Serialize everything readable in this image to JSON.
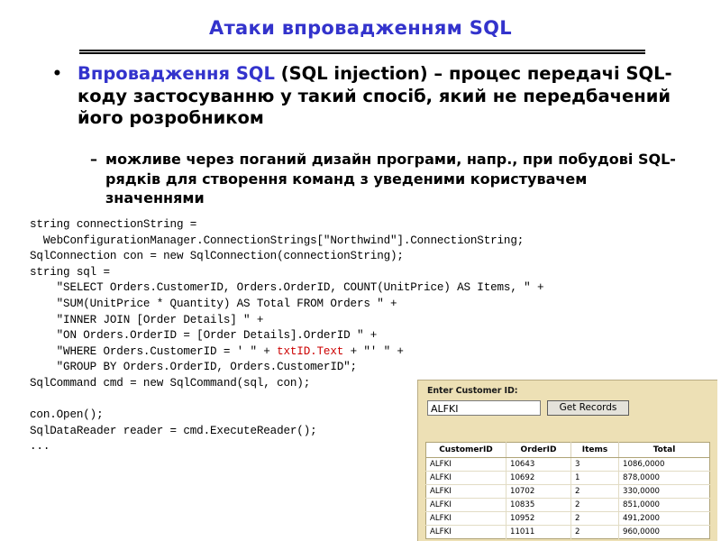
{
  "slide": {
    "title": "Атаки впровадженням SQL",
    "accent_color": "#3333CC",
    "bullet1": {
      "marker": "•",
      "accent_text": "Впровадження SQL",
      "rest_text": " (SQL injection) – процес передачі SQL-коду застосуванню у такий спосіб, який не передбачений його розробником"
    },
    "bullet2": {
      "marker": "–",
      "text": "можливе через поганий дизайн програми, напр., при побудові SQL-рядків для створення команд з уведеними користувачем значеннями"
    },
    "code": {
      "red_color": "#CC0000",
      "lines": [
        {
          "text": "string connectionString ="
        },
        {
          "text": "  WebConfigurationManager.ConnectionStrings[\"Northwind\"].ConnectionString;"
        },
        {
          "text": "SqlConnection con = new SqlConnection(connectionString);"
        },
        {
          "text": "string sql ="
        },
        {
          "text": "    \"SELECT Orders.CustomerID, Orders.OrderID, COUNT(UnitPrice) AS Items, \" +"
        },
        {
          "text": "    \"SUM(UnitPrice * Quantity) AS Total FROM Orders \" +"
        },
        {
          "text": "    \"INNER JOIN [Order Details] \" +"
        },
        {
          "text": "    \"ON Orders.OrderID = [Order Details].OrderID \" +"
        },
        {
          "pre": "    \"WHERE Orders.CustomerID = ' \" + ",
          "red": "txtID.Text",
          "post": " + \"' \" +"
        },
        {
          "text": "    \"GROUP BY Orders.OrderID, Orders.CustomerID\";"
        },
        {
          "text": "SqlCommand cmd = new SqlCommand(sql, con);"
        },
        {
          "text": ""
        },
        {
          "text": "con.Open();"
        },
        {
          "text": "SqlDataReader reader = cmd.ExecuteReader();"
        },
        {
          "text": "..."
        }
      ]
    },
    "form": {
      "background_color": "#EDE0B5",
      "label": "Enter Customer ID:",
      "input_value": "ALFKI",
      "input_placeholder": "",
      "button_label": "Get Records",
      "grid": {
        "columns": [
          "CustomerID",
          "OrderID",
          "Items",
          "Total"
        ],
        "rows": [
          [
            "ALFKI",
            "10643",
            "3",
            "1086,0000"
          ],
          [
            "ALFKI",
            "10692",
            "1",
            "878,0000"
          ],
          [
            "ALFKI",
            "10702",
            "2",
            "330,0000"
          ],
          [
            "ALFKI",
            "10835",
            "2",
            "851,0000"
          ],
          [
            "ALFKI",
            "10952",
            "2",
            "491,2000"
          ],
          [
            "ALFKI",
            "11011",
            "2",
            "960,0000"
          ]
        ]
      }
    }
  }
}
